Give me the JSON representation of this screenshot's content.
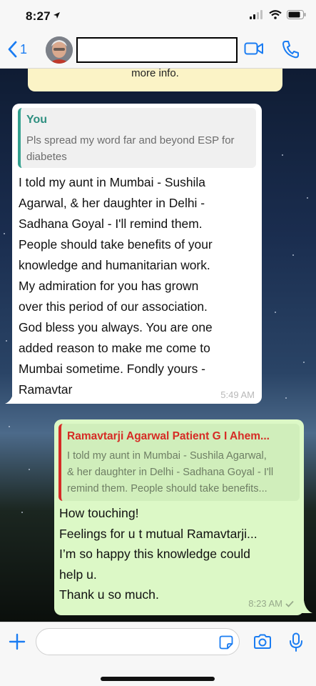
{
  "status_bar": {
    "time": "8:27"
  },
  "header": {
    "back_count": "1"
  },
  "chat": {
    "system_text": "more info.",
    "incoming": {
      "quote_name": "You",
      "quote_text": "Pls spread my word far and beyond ESP for diabetes",
      "text": "I told my aunt in Mumbai - Sushila\nAgarwal, & her daughter in Delhi -\nSadhana Goyal - I'll remind them.\nPeople should take benefits of your\nknowledge and humanitarian work.\nMy admiration for you has grown\nover this period of our association.\nGod bless you always. You are one\nadded reason to make me come to\nMumbai sometime. Fondly yours -\nRamavtar",
      "time": "5:49 AM"
    },
    "outgoing": {
      "quote_name": "Ramavtarji Agarwal Patient G I Ahem...",
      "quote_text": "I told my aunt in Mumbai - Sushila Agarwal,\n& her daughter in Delhi - Sadhana Goyal - I'll\nremind them. People should take benefits...",
      "text": "How touching!\nFeelings for u t mutual Ramavtarji...\nI’m so happy this knowledge could\nhelp u.\nThank u so much.",
      "time": "8:23 AM"
    }
  },
  "input": {
    "placeholder": ""
  },
  "colors": {
    "accent": "#1a7cf2",
    "incoming_bubble": "#ffffff",
    "outgoing_bubble": "#dcf8c6",
    "quote_you": "#2e8f80",
    "quote_reply": "#d62b25"
  }
}
